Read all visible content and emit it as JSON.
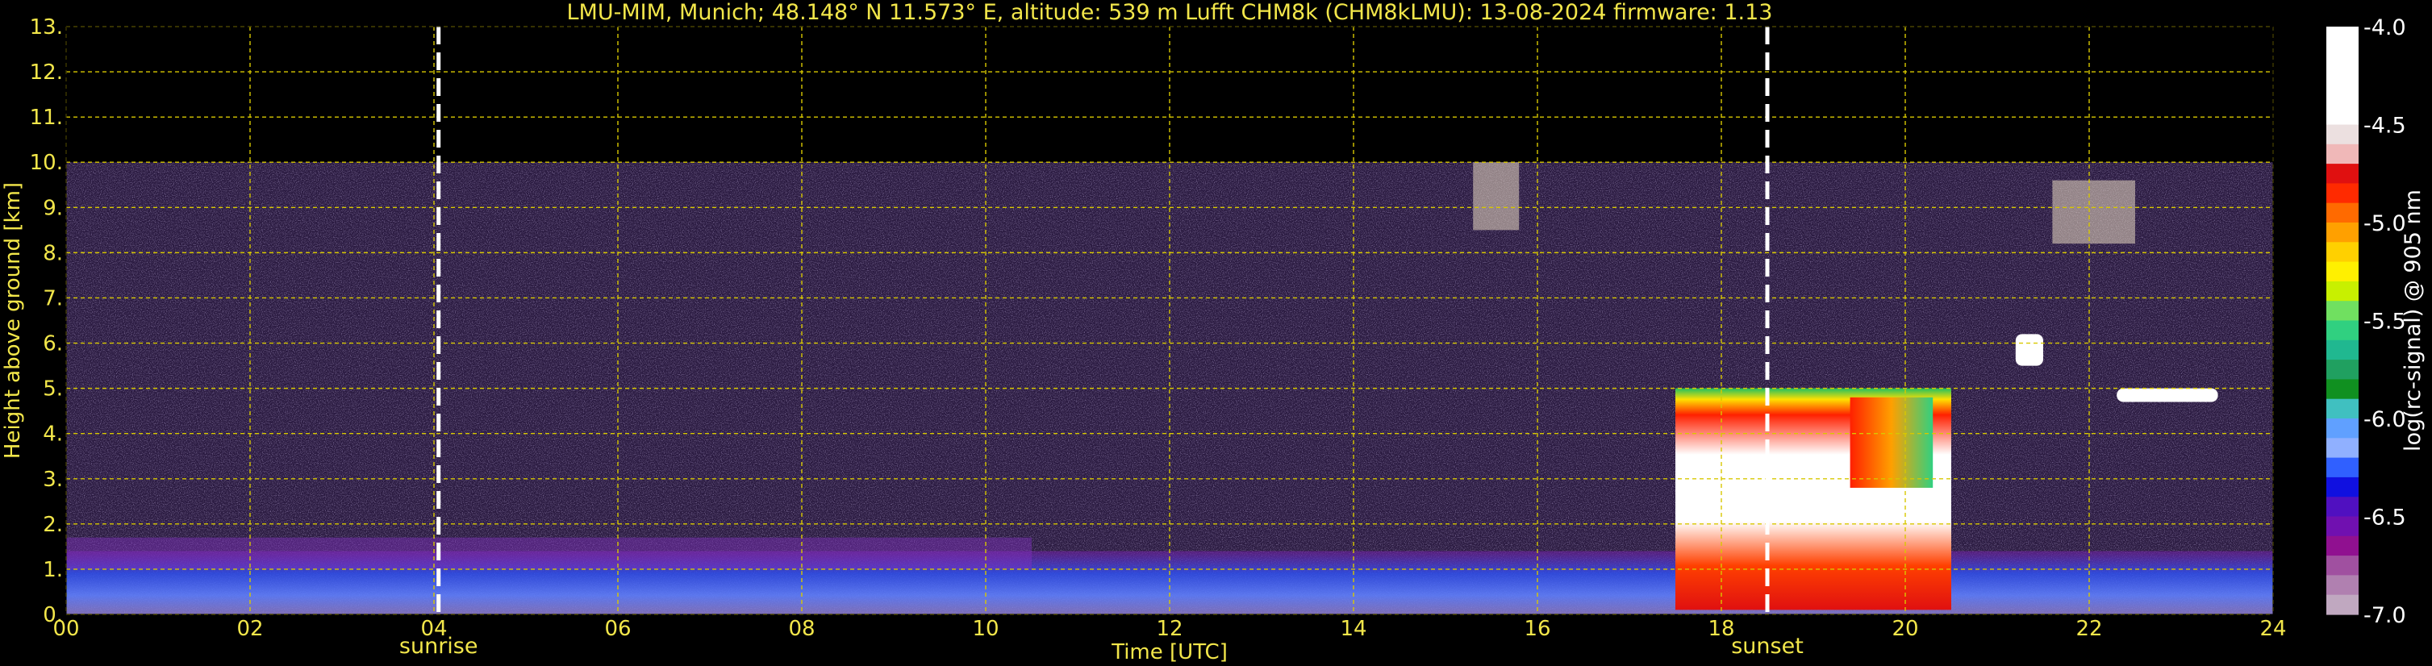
{
  "chart_data": {
    "type": "heatmap",
    "title": "LMU-MIM, Munich; 48.148° N 11.573° E, altitude: 539 m    Lufft CHM8k (CHM8kLMU): 13-08-2024    firmware: 1.13",
    "xlabel": "Time [UTC]",
    "ylabel": "Height above ground [km]",
    "xlim": [
      0,
      24
    ],
    "ylim": [
      0,
      13
    ],
    "x_tick_labels": [
      "00",
      "02",
      "04",
      "06",
      "08",
      "10",
      "12",
      "14",
      "16",
      "18",
      "20",
      "22",
      "24"
    ],
    "y_tick_labels": [
      "0.",
      "1.",
      "2.",
      "3.",
      "4.",
      "5.",
      "6.",
      "7.",
      "8.",
      "9.",
      "10.",
      "11.",
      "12.",
      "13."
    ],
    "grid": true,
    "data_ceiling_km": 10,
    "sunrise": {
      "label": "sunrise",
      "time": 4.05
    },
    "sunset": {
      "label": "sunset",
      "time": 18.5
    },
    "colorbar": {
      "label": "log(rc-signal) @ 905 nm",
      "range": [
        -7.0,
        -4.0
      ],
      "tick_labels": [
        "-4.0",
        "-4.5",
        "-5.0",
        "-5.5",
        "-6.0",
        "-6.5",
        "-7.0"
      ],
      "colors": [
        "#ffffff",
        "#ffffff",
        "#ffffff",
        "#ffffff",
        "#ffffff",
        "#ece0e0",
        "#f0b8b8",
        "#e01010",
        "#ff2a00",
        "#ff6a00",
        "#ffa000",
        "#ffd000",
        "#fff000",
        "#c8f000",
        "#70e060",
        "#30d080",
        "#20b890",
        "#20a060",
        "#109020",
        "#40c0c0",
        "#60a0ff",
        "#90b0ff",
        "#3060ff",
        "#1010e0",
        "#5010c0",
        "#7010b0",
        "#901090",
        "#a050a0",
        "#b080b0",
        "#c0a8c0"
      ]
    },
    "features": [
      {
        "name": "boundary-layer-aerosol",
        "t0": 0,
        "t1": 24,
        "h0": 0,
        "h1": 1.4
      },
      {
        "name": "residual-layer",
        "t0": 0,
        "t1": 10.5,
        "h0": 1.0,
        "h1": 1.7
      },
      {
        "name": "convective-cloud-system",
        "t0": 17.5,
        "t1": 20.5,
        "h0": 0.1,
        "h1": 5.0
      },
      {
        "name": "cloud-19-20h",
        "t0": 19.4,
        "t1": 20.3,
        "h0": 2.8,
        "h1": 4.8
      },
      {
        "name": "high-cloud-21h",
        "t0": 21.2,
        "t1": 21.5,
        "h0": 5.5,
        "h1": 6.2
      },
      {
        "name": "high-cloud-22h",
        "t0": 22.3,
        "t1": 23.4,
        "h0": 4.7,
        "h1": 5.0
      },
      {
        "name": "cirrus-15h",
        "t0": 15.3,
        "t1": 15.8,
        "h0": 8.5,
        "h1": 10.0
      },
      {
        "name": "cirrus-22h",
        "t0": 21.6,
        "t1": 22.5,
        "h0": 8.2,
        "h1": 9.6
      }
    ]
  }
}
